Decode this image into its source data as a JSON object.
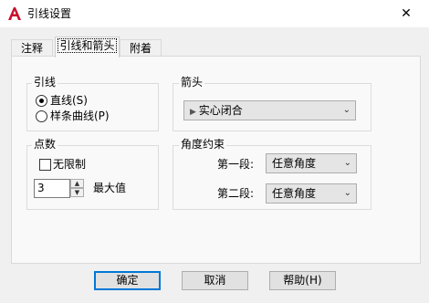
{
  "window": {
    "title": "引线设置",
    "close_glyph": "✕",
    "app_icon": "autocad-logo-icon"
  },
  "tabs": [
    {
      "label": "注释",
      "active": false
    },
    {
      "label": "引线和箭头",
      "active": true
    },
    {
      "label": "附着",
      "active": false
    }
  ],
  "leader_group": {
    "title": "引线",
    "options": [
      {
        "label": "直线(S)",
        "checked": true
      },
      {
        "label": "样条曲线(P)",
        "checked": false
      }
    ]
  },
  "points_group": {
    "title": "点数",
    "unlimited_label": "无限制",
    "unlimited_checked": false,
    "max_value": "3",
    "max_label": "最大值"
  },
  "arrow_group": {
    "title": "箭头",
    "selected": "实心闭合"
  },
  "angle_group": {
    "title": "角度约束",
    "first_label": "第一段:",
    "first_value": "任意角度",
    "second_label": "第二段:",
    "second_value": "任意角度"
  },
  "buttons": {
    "ok": "确定",
    "cancel": "取消",
    "help": "帮助(H)"
  },
  "colors": {
    "accent": "#0078d7",
    "logo_red": "#c8102e"
  }
}
